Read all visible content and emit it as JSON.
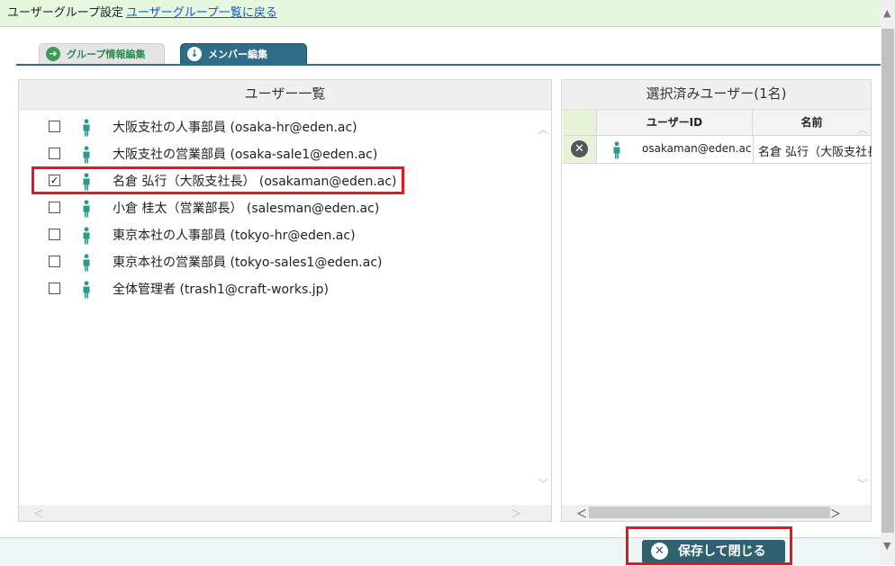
{
  "header": {
    "title": "ユーザーグループ設定",
    "back_link": "ユーザーグループ一覧に戻る"
  },
  "tabs": [
    {
      "label": "グループ情報編集",
      "icon": "arrow-right-icon",
      "active": false
    },
    {
      "label": "メンバー編集",
      "icon": "arrow-down-icon",
      "active": true
    }
  ],
  "user_list": {
    "title": "ユーザー一覧",
    "items": [
      {
        "label": "大阪支社の人事部員 (osaka-hr@eden.ac)",
        "checked": false
      },
      {
        "label": "大阪支社の営業部員 (osaka-sale1@eden.ac)",
        "checked": false
      },
      {
        "label": "名倉 弘行（大阪支社長） (osakaman@eden.ac)",
        "checked": true
      },
      {
        "label": "小倉 桂太（営業部長） (salesman@eden.ac)",
        "checked": false
      },
      {
        "label": "東京本社の人事部員 (tokyo-hr@eden.ac)",
        "checked": false
      },
      {
        "label": "東京本社の営業部員 (tokyo-sales1@eden.ac)",
        "checked": false
      },
      {
        "label": "全体管理者 (trash1@craft-works.jp)",
        "checked": false
      }
    ]
  },
  "selected_users": {
    "title": "選択済みユーザー(1名)",
    "columns": [
      "ユーザーID",
      "名前"
    ],
    "rows": [
      {
        "user_id": "osakaman@eden.ac",
        "name": "名倉 弘行（大阪支社長）"
      }
    ]
  },
  "footer": {
    "save_label": "保存して閉じる"
  },
  "colors": {
    "header_bg": "#e6f7e0",
    "tab_active": "#2d6d87",
    "person_icon": "#2a9a8e",
    "highlight": "#e8141e",
    "save_button": "#2f6170"
  }
}
